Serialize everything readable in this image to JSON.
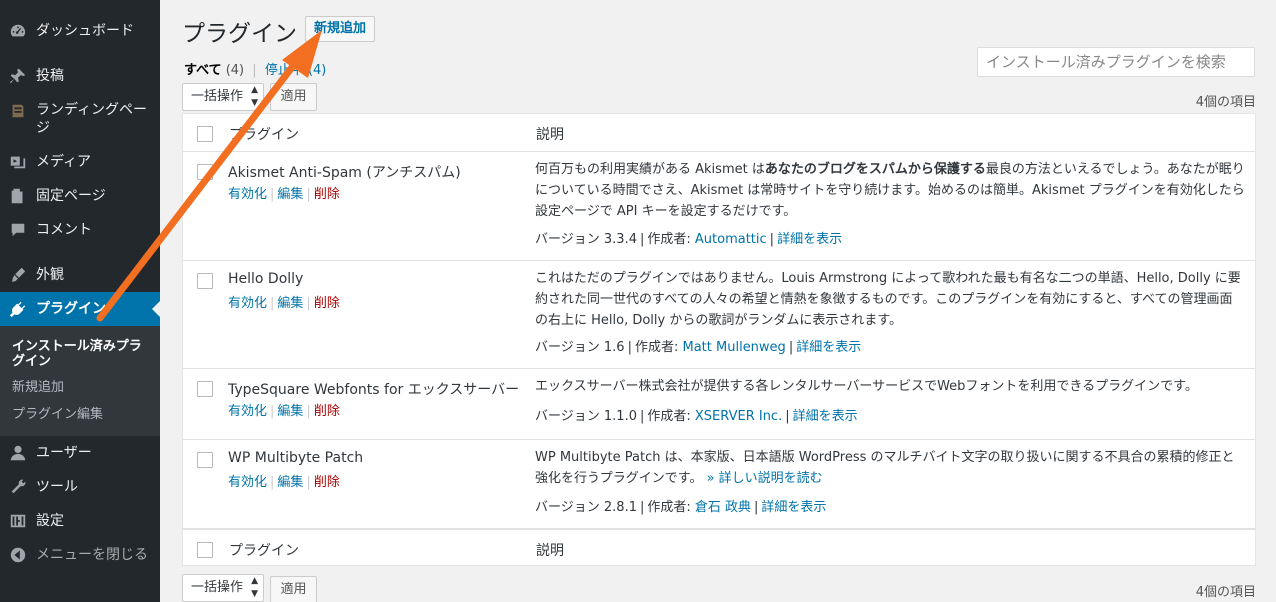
{
  "sidebar": {
    "items": [
      {
        "label": "ダッシュボード",
        "icon": "dashboard-icon"
      },
      {
        "label": "投稿",
        "icon": "pin-icon"
      },
      {
        "label": "ランディングページ",
        "icon": "landing-page-icon"
      },
      {
        "label": "メディア",
        "icon": "media-icon"
      },
      {
        "label": "固定ページ",
        "icon": "page-icon"
      },
      {
        "label": "コメント",
        "icon": "comment-icon"
      },
      {
        "label": "外観",
        "icon": "appearance-icon"
      },
      {
        "label": "プラグイン",
        "icon": "plugin-icon"
      },
      {
        "label": "ユーザー",
        "icon": "user-icon"
      },
      {
        "label": "ツール",
        "icon": "tool-icon"
      },
      {
        "label": "設定",
        "icon": "settings-icon"
      },
      {
        "label": "メニューを閉じる",
        "icon": "collapse-icon"
      }
    ],
    "submenu": [
      {
        "label": "インストール済みプラグイン"
      },
      {
        "label": "新規追加"
      },
      {
        "label": "プラグイン編集"
      }
    ]
  },
  "header": {
    "title": "プラグイン",
    "add_new": "新規追加",
    "filter_all": "すべて",
    "filter_all_count": "(4)",
    "filter_inactive": "停止中 (4)",
    "search_placeholder": "インストール済みプラグインを検索"
  },
  "tablenav": {
    "bulk_action": "一括操作",
    "apply": "適用",
    "items_count": "4個の項目"
  },
  "table": {
    "col_plugin": "プラグイン",
    "col_desc": "説明",
    "actions": {
      "activate": "有効化",
      "edit": "編集",
      "delete": "削除"
    },
    "meta_labels": {
      "version": "バージョン",
      "by": "作成者:",
      "details": "詳細を表示"
    },
    "plugins": [
      {
        "name": "Akismet Anti-Spam (アンチスパム)",
        "desc_pre": "何百万もの利用実績がある Akismet は",
        "desc_bold": "あなたのブログをスパムから保護する",
        "desc_post": "最良の方法といえるでしょう。あなたが眠りについている時間でさえ、Akismet は常時サイトを守り続けます。始めるのは簡単。Akismet プラグインを有効化したら設定ページで API キーを設定するだけです。",
        "version": "3.3.4",
        "author": "Automattic"
      },
      {
        "name": "Hello Dolly",
        "desc": "これはただのプラグインではありません。Louis Armstrong によって歌われた最も有名な二つの単語、Hello, Dolly に要約された同一世代のすべての人々の希望と情熱を象徴するものです。このプラグインを有効にすると、すべての管理画面の右上に Hello, Dolly からの歌詞がランダムに表示されます。",
        "version": "1.6",
        "author": "Matt Mullenweg"
      },
      {
        "name": "TypeSquare Webfonts for エックスサーバー",
        "desc": "エックスサーバー株式会社が提供する各レンタルサーバーサービスでWebフォントを利用できるプラグインです。",
        "version": "1.1.0",
        "author": "XSERVER Inc."
      },
      {
        "name": "WP Multibyte Patch",
        "desc": "WP Multibyte Patch は、本家版、日本語版 WordPress のマルチバイト文字の取り扱いに関する不具合の累積的修正と強化を行うプラグインです。",
        "desc_link": "» 詳しい説明を読む",
        "version": "2.8.1",
        "author": "倉石 政典"
      }
    ]
  },
  "colors": {
    "sidebar_bg": "#23282d",
    "accent": "#0073aa",
    "delete": "#aa0000",
    "arrow": "#f26f21"
  }
}
